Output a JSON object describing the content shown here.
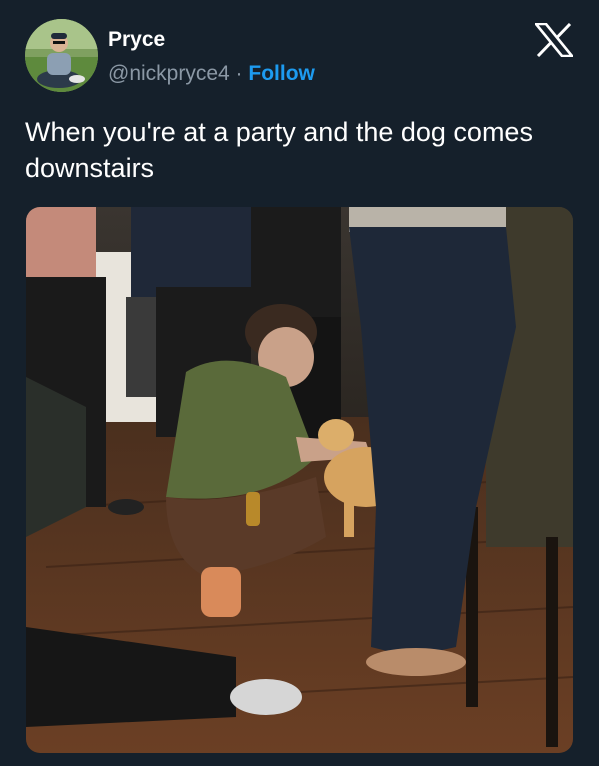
{
  "tweet": {
    "author_name": "Pryce",
    "author_handle": "@nickpryce4",
    "separator": "·",
    "follow_label": "Follow",
    "text": "When you're at a party and the dog comes downstairs"
  },
  "icons": {
    "platform_logo": "x-logo-icon",
    "avatar": "avatar-photo"
  },
  "media": {
    "description_type": "photo"
  },
  "colors": {
    "background": "#15202b",
    "text_primary": "#ffffff",
    "text_secondary": "#8b98a5",
    "accent": "#1d9bf0"
  }
}
